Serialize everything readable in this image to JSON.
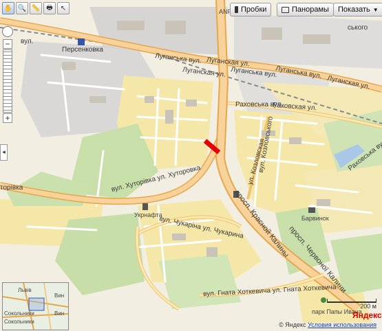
{
  "toolbar": {
    "tools": [
      {
        "name": "drag-tool-icon",
        "glyph": "✋"
      },
      {
        "name": "zoom-tool-icon",
        "glyph": "🔍"
      },
      {
        "name": "ruler-tool-icon",
        "glyph": "📏"
      },
      {
        "name": "print-tool-icon",
        "glyph": "🖶"
      },
      {
        "name": "cursor-tool-icon",
        "glyph": "↖"
      }
    ]
  },
  "buttons": {
    "traffic": "Пробки",
    "panoramas": "Панорамы",
    "show": "Показать"
  },
  "labels": {
    "station": "Персенковка",
    "lugansk1": "Луганська вул.",
    "lugansk2": "Луганская ул.",
    "lugansk3": "Луганская ул.",
    "lugansk4": "Луганська вул.",
    "lugansk5": "Луганская ул.",
    "lugansk6": "Луганська вул.",
    "rakhovska": "Раховська вул.",
    "rakhovskaya": "Раховская ул.",
    "rakhovska2": "Раховська вул.",
    "khutorivka": "вул. Хуторівка ул. Хуторовка",
    "torivka": "торівка",
    "chukarina": "вул. Чукаріна ул. Чукарина",
    "hnata": "вул. Гната Хоткевича ул. Гната Хоткевича",
    "kozlovska": "ул. Козловская",
    "kozlovskoho": "вул. Козловського",
    "krasnoy": "просп. Красной Калины",
    "chervonoi": "просп. Червоної Калини",
    "ukrnafta": "Укрнафта",
    "barvinok": "Барвинок",
    "anp": "ANP",
    "park": "парк Папы Ивана",
    "skoho": "ського",
    "vul": "вул."
  },
  "minimap": {
    "city1": "Львів",
    "city2": "Вин",
    "city3": "Сокольники",
    "city4": "Сокольники",
    "city5": "Вин"
  },
  "footer": {
    "scale": "200 м",
    "copyright": "© Яндекс",
    "terms": "Условия использования",
    "logo": "Яндекс"
  }
}
